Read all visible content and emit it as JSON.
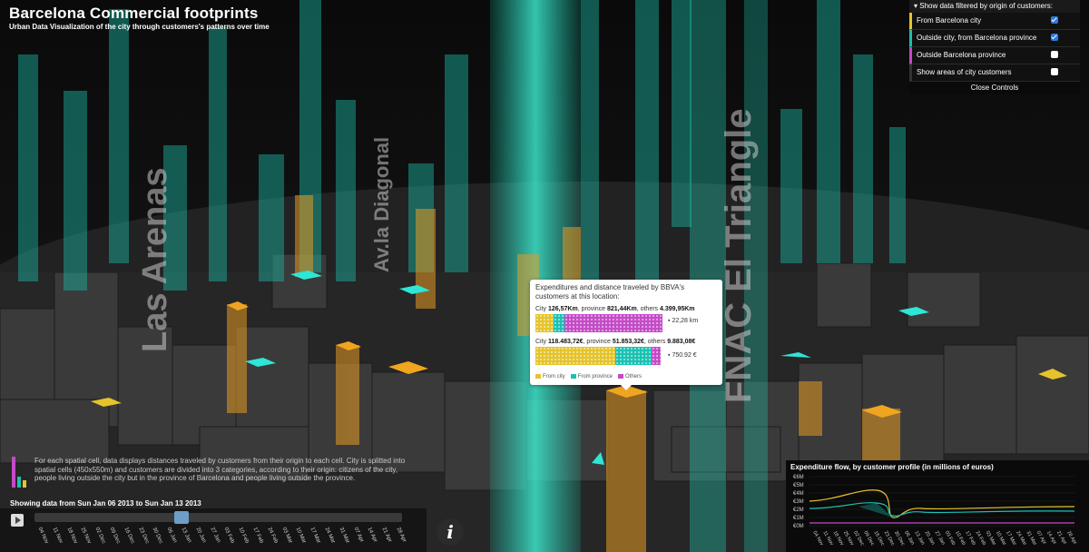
{
  "app": {
    "title": "Barcelona Commercial footprints",
    "subtitle": "Urban Data Visualization of the city through customers's patterns over time"
  },
  "streets": [
    {
      "label": "Las Arenas"
    },
    {
      "label": "Av.la Diagonal"
    },
    {
      "label": "FNAC El Triangle"
    }
  ],
  "controls": {
    "header": "Show data filtered by origin of customers:",
    "items": [
      {
        "label": "From Barcelona city",
        "color": "#e5c32b",
        "checked": true
      },
      {
        "label": "Outside city, from Barcelona province",
        "color": "#19c1b3",
        "checked": true
      },
      {
        "label": "Outside Barcelona province",
        "color": "#c44ac7",
        "checked": false
      },
      {
        "label": "Show areas of city customers",
        "color": "#333333",
        "checked": false
      }
    ],
    "close_label": "Close Controls"
  },
  "tooltip": {
    "heading": "Expenditures and distance traveled by BBVA's customers at this location:",
    "distance": {
      "pre1": "City ",
      "city": "126,57Km",
      "pre2": ", province ",
      "province": "821,44Km",
      "pre3": ", others ",
      "others": "4.399,95Km",
      "key": "22,28 km"
    },
    "expense": {
      "pre1": "City ",
      "city": "118.483,72€",
      "pre2": ", province ",
      "province": "51.853,32€",
      "pre3": ", others ",
      "others": "9.883,08€",
      "key": "750.92 €"
    },
    "legend": [
      "From city",
      "From province",
      "Others"
    ]
  },
  "description": "For each spatial cell, data displays distances traveled by customers from their origin to each cell. City is splitted into spatial cells (450x550m) and customers are divided into 3 categories, according to their origin: citizens of the city, people living outside the city but in the province of Barcelona and people living outside the province.",
  "timeline": {
    "range_label": "Showing data from Sun Jan 06 2013 to Sun Jan 13 2013",
    "progress": 0.38,
    "ticks": [
      "04 Nov",
      "11 Nov",
      "18 Nov",
      "25 Nov",
      "02 Dec",
      "09 Dec",
      "16 Dec",
      "23 Dec",
      "30 Dec",
      "06 Jan",
      "13 Jan",
      "20 Jan",
      "27 Jan",
      "03 Feb",
      "10 Feb",
      "17 Feb",
      "24 Feb",
      "03 Mar",
      "10 Mar",
      "17 Mar",
      "24 Mar",
      "31 Mar",
      "07 Apr",
      "14 Apr",
      "21 Apr",
      "28 Apr"
    ]
  },
  "info_button": "i",
  "flow": {
    "title": "Expenditure flow, by customer profile (in millions of euros)",
    "y_ticks": [
      "€6M",
      "€5M",
      "€4M",
      "€3M",
      "€2M",
      "€1M",
      "€0M"
    ],
    "x_ticks": [
      "04 Nov",
      "11 Nov",
      "18 Nov",
      "25 Nov",
      "02 Dec",
      "09 Dec",
      "16 Dec",
      "23 Dec",
      "30 Dec",
      "06 Jan",
      "13 Jan",
      "20 Jan",
      "27 Jan",
      "03 Feb",
      "10 Feb",
      "17 Feb",
      "24 Feb",
      "03 Mar",
      "10 Mar",
      "17 Mar",
      "24 Mar",
      "31 Mar",
      "07 Apr",
      "14 Apr",
      "21 Apr",
      "28 Apr"
    ],
    "colors": {
      "city": "#e5c32b",
      "province": "#19c1b3",
      "others": "#c44ac7"
    }
  }
}
